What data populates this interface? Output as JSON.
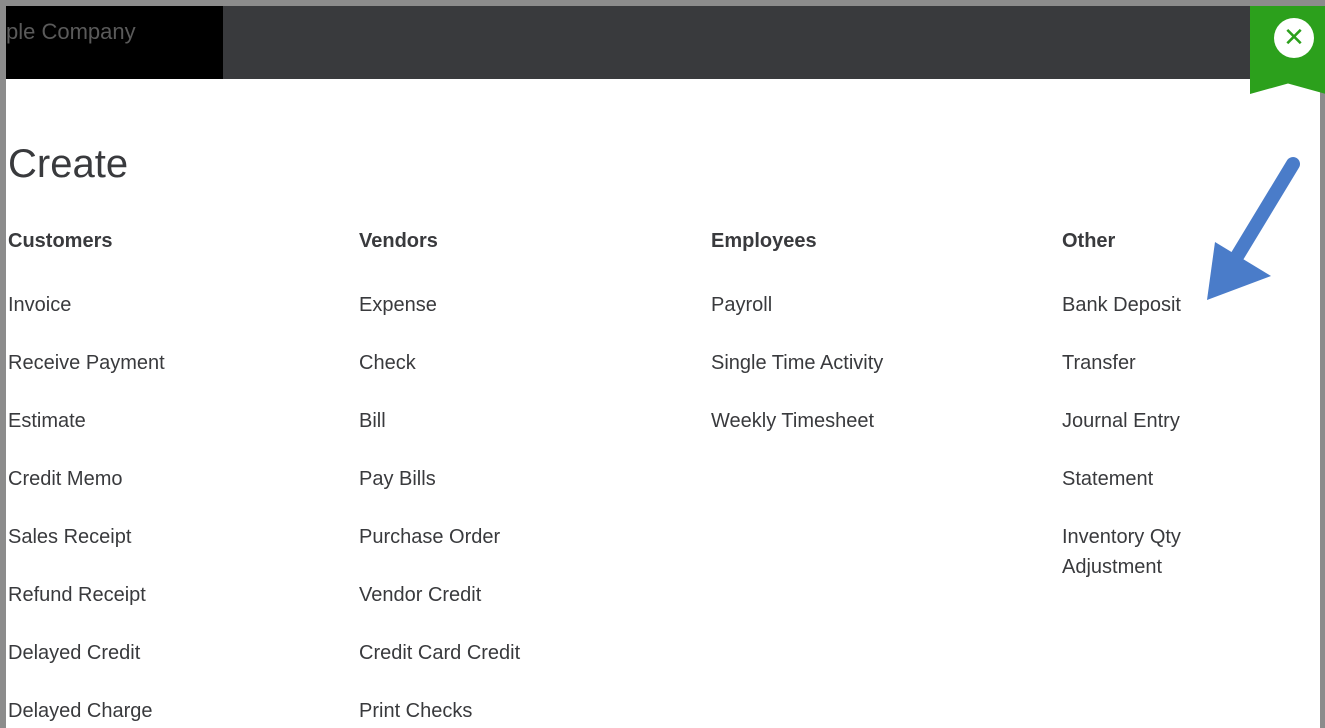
{
  "header": {
    "company_name": "ple Company",
    "close_icon": "close-icon"
  },
  "page": {
    "title": "Create"
  },
  "columns": [
    {
      "heading": "Customers",
      "items": [
        "Invoice",
        "Receive Payment",
        "Estimate",
        "Credit Memo",
        "Sales Receipt",
        "Refund Receipt",
        "Delayed Credit",
        "Delayed Charge"
      ]
    },
    {
      "heading": "Vendors",
      "items": [
        "Expense",
        "Check",
        "Bill",
        "Pay Bills",
        "Purchase Order",
        "Vendor Credit",
        "Credit Card Credit",
        "Print Checks"
      ]
    },
    {
      "heading": "Employees",
      "items": [
        "Payroll",
        "Single Time Activity",
        "Weekly Timesheet"
      ]
    },
    {
      "heading": "Other",
      "items": [
        "Bank Deposit",
        "Transfer",
        "Journal Entry",
        "Statement",
        "Inventory Qty Adjustment"
      ]
    }
  ],
  "colors": {
    "brand_green": "#2ca01c",
    "topbar": "#393a3d",
    "arrow": "#4a7cc9"
  }
}
